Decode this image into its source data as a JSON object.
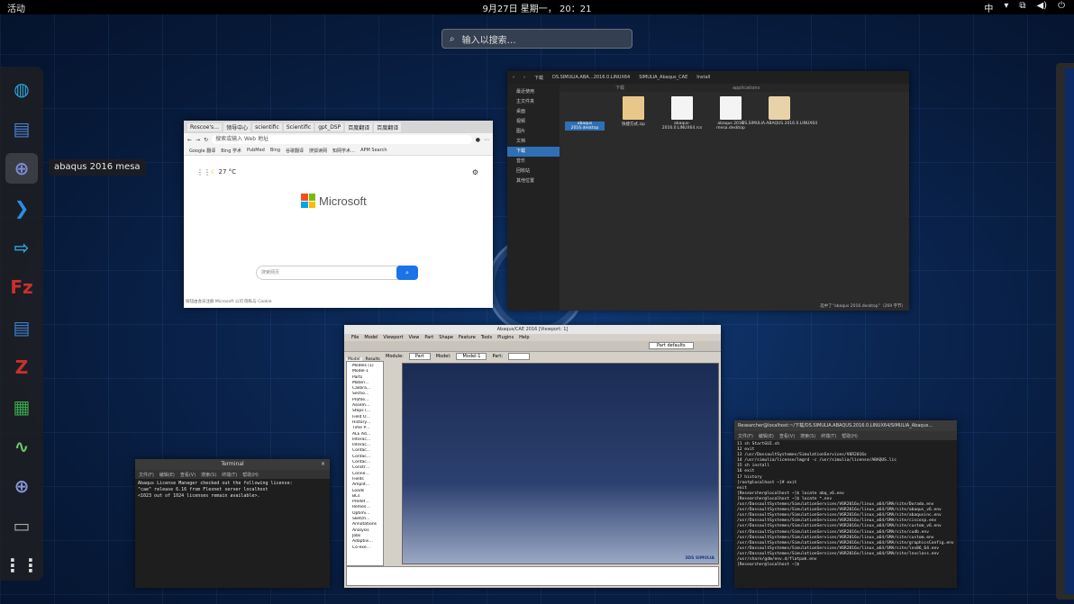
{
  "topbar": {
    "activities": "活动",
    "clock": "9月27日 星期一， 20：21",
    "input_method": "中",
    "tray_icons": [
      "network-icon",
      "volume-icon",
      "power-icon"
    ]
  },
  "search": {
    "placeholder": "输入以搜索…"
  },
  "dock": {
    "items": [
      {
        "name": "edge-beta",
        "glyph": "◍",
        "color": "#2aa9e0"
      },
      {
        "name": "text-editor",
        "glyph": "▤",
        "color": "#4a7fd0"
      },
      {
        "name": "abaqus",
        "glyph": "⊕",
        "color": "#7c8cd8"
      },
      {
        "name": "vscode",
        "glyph": "❯",
        "color": "#2a8ee6"
      },
      {
        "name": "remote-desktop",
        "glyph": "⇨",
        "color": "#25a7d8"
      },
      {
        "name": "filezilla",
        "glyph": "Fz",
        "color": "#c9302c"
      },
      {
        "name": "writer",
        "glyph": "▤",
        "color": "#3a7fd0"
      },
      {
        "name": "zotero",
        "glyph": "Z",
        "color": "#c9302c"
      },
      {
        "name": "calc",
        "glyph": "▦",
        "color": "#3aa64a"
      },
      {
        "name": "system-monitor",
        "glyph": "∿",
        "color": "#6ac86a"
      },
      {
        "name": "abaqus-cae",
        "glyph": "⊕",
        "color": "#8a96d8"
      },
      {
        "name": "terminal",
        "glyph": "▭",
        "color": "#aaaaaa"
      },
      {
        "name": "app-grid",
        "glyph": "⋮⋮",
        "color": "#e0e0e0"
      }
    ],
    "tooltip": "abaqus 2016 mesa"
  },
  "browser": {
    "tabs": [
      "Roscoe's…",
      "领导中心",
      "scientific",
      "Scientific",
      "gpt_DSP",
      "百度翻译",
      "百度翻译"
    ],
    "address": "搜索或输入 Web 地址",
    "favorites": [
      "Google 翻译",
      "Bing 学术",
      "PubMed",
      "Bing",
      "谷歌翻译",
      "搜狐读网",
      "知网学术…",
      "APM Search"
    ],
    "weather": "27 °C",
    "logo_text": "Microsoft",
    "search_placeholder": "搜索网页",
    "footer": "按钮由会员注册 Microsoft 公司 隐私与 Cookie"
  },
  "files": {
    "path": [
      "下载",
      "DS.SIMULIA.ABA…2016.0.LINUX64",
      "SIMULIA_Abaqus_CAE",
      "Install"
    ],
    "tabs": [
      "下载",
      "applications"
    ],
    "sidebar": [
      "最近使用",
      "主文件夹",
      "桌面",
      "视频",
      "图片",
      "文档",
      "下载",
      "音乐",
      "回收站",
      "其他位置"
    ],
    "selected_sidebar": "下载",
    "items": [
      {
        "name": "abaqus 2016.desktop",
        "icon": "desktop-file-icon"
      },
      {
        "name": "快捷方式.zip",
        "icon": "zip-icon"
      },
      {
        "name": "abaqus-2016.0.LINUX64.rcs",
        "icon": "document-icon"
      },
      {
        "name": "abaqus 2016 mesa.desktop",
        "icon": "document-icon"
      },
      {
        "name": "DS.SIMULIA.ABAQUS.2016.0.LINUX64",
        "icon": "folder-icon"
      }
    ],
    "status": "选中了“abaqus 2016.desktop”（269 字节）"
  },
  "abaqus": {
    "title": "Abaqus/CAE 2016 [Viewport: 1]",
    "menu": [
      "File",
      "Model",
      "Viewport",
      "View",
      "Part",
      "Shape",
      "Feature",
      "Tools",
      "Plugins",
      "Help"
    ],
    "module_label": "Module:",
    "module_value": "Part",
    "model_label": "Model:",
    "model_value": "Model-1",
    "part_label": "Part:",
    "defaults": "Part defaults",
    "tabs": [
      "Model",
      "Results"
    ],
    "tree": [
      "Models (1)",
      "Model-1",
      "Parts",
      "Materi…",
      "Calibra…",
      "Sectio…",
      "Profile…",
      "Assem…",
      "Steps (…",
      "Field O…",
      "History…",
      "Time P…",
      "ALE Ad…",
      "Interac…",
      "Interac…",
      "Contac…",
      "Contac…",
      "Contac…",
      "Constr…",
      "Conne…",
      "Fields",
      "Amplit…",
      "Loads",
      "BCs",
      "Predef…",
      "Remes…",
      "Optimi…",
      "Sketch…",
      "Annotations",
      "Analysis",
      "Jobs",
      "Adaptivi…",
      "Co-exe…"
    ],
    "brand": "3DS SIMULIA"
  },
  "terminal1": {
    "title": "Terminal",
    "menu": [
      "文件(F)",
      "编辑(E)",
      "查看(V)",
      "搜索(S)",
      "终端(T)",
      "帮助(H)"
    ],
    "lines": [
      "Abaqus License Manager checked out the following license:",
      "\"cae\" release 6.16 from Flexnet server localhost",
      "<1023 out of 1024 licenses remain available>."
    ]
  },
  "terminal2": {
    "title": "Researcher@localhost:~/下载/DS.SIMULIA.ABAQUS.2016.0.LINUX64/SIMULIA_Abaqus…",
    "menu": [
      "文件(F)",
      "编辑(E)",
      "查看(V)",
      "搜索(S)",
      "终端(T)",
      "帮助(H)"
    ],
    "lines": [
      "   11  sh StartGUI.sh",
      "   12  exit",
      "   13  /usr/DassaultSystemes/SimulationServices/V6R2016x",
      "   14  /usr/simulia/license/lmgrd -c /usr/simulia/license/ABAQUS.lic",
      "   15  sh install",
      "   16  exit",
      "   17  history",
      "[root@localhost ~]# exit",
      "exit",
      "[Researcher@localhost ~]$ locate abq_v6.env",
      "[Researcher@localhost ~]$ locate *.env",
      "/usr/DassaultSystemes/SimulationServices/V6R2016x/linux_a64/SMA/site/Dorado.env",
      "/usr/DassaultSystemes/SimulationServices/V6R2016x/linux_a64/SMA/site/abaqus_v6.env",
      "/usr/DassaultSystemes/SimulationServices/V6R2016x/linux_a64/SMA/site/abaqusinc.env",
      "/usr/DassaultSystemes/SimulationServices/V6R2016x/linux_a64/SMA/site/ciscosp.env",
      "/usr/DassaultSystemes/SimulationServices/V6R2016x/linux_a64/SMA/site/custom_v6.env",
      "/usr/DassaultSystemes/SimulationServices/V6R2016x/linux_a64/SMA/site/cudb.env",
      "/usr/DassaultSystemes/SimulationServices/V6R2016x/linux_a64/SMA/site/custom.env",
      "/usr/DassaultSystemes/SimulationServices/V6R2016x/linux_a64/SMA/site/graphicsConfig.env",
      "/usr/DassaultSystemes/SimulationServices/V6R2016x/linux_a64/SMA/site/lnx86_64.env",
      "/usr/DassaultSystemes/SimulationServices/V6R2016x/linux_a64/SMA/site/lnxclass.env",
      "/usr/share/gdm/env.d/flatpak.env",
      "[Researcher@localhost ~]$ "
    ]
  }
}
